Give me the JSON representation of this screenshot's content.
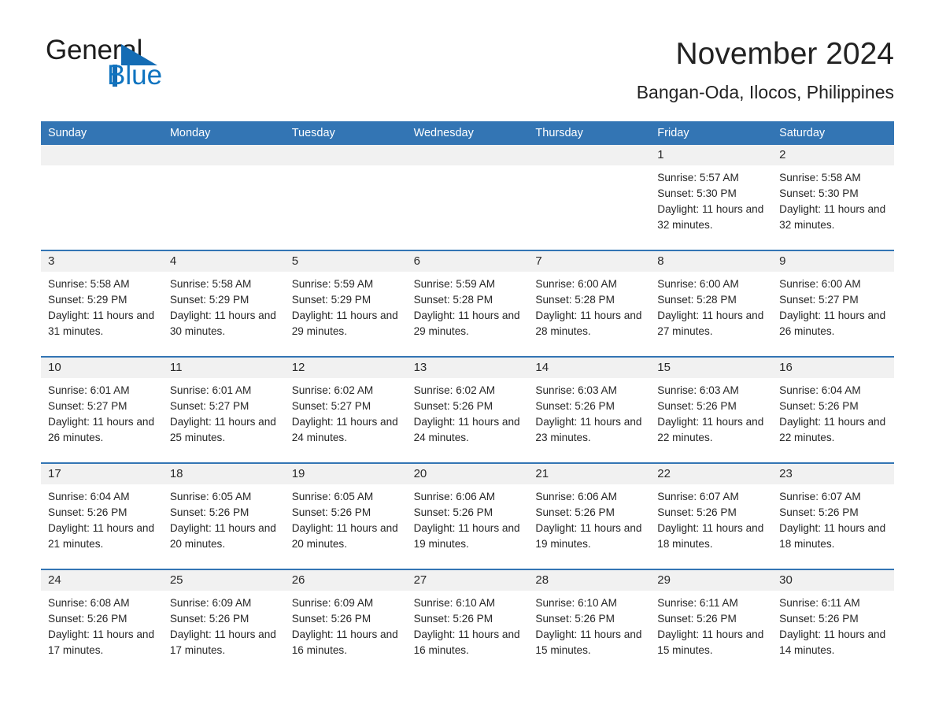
{
  "brand": {
    "word_one": "General",
    "word_two": "Blue",
    "triangle_color": "#146cb4",
    "blue_text_color": "#0f74c0",
    "dark_text_color": "#1c1c1c"
  },
  "header": {
    "month_title": "November 2024",
    "location": "Bangan-Oda, Ilocos, Philippines"
  },
  "theme": {
    "header_blue": "#3375b4",
    "date_band_gray": "#f1f1f1",
    "rule_blue": "#3375b4",
    "text_color": "#262626"
  },
  "calendar": {
    "weekdays": [
      "Sunday",
      "Monday",
      "Tuesday",
      "Wednesday",
      "Thursday",
      "Friday",
      "Saturday"
    ],
    "weeks": [
      [
        {
          "day": "",
          "sunrise": "",
          "sunset": "",
          "daylight": "",
          "empty": true
        },
        {
          "day": "",
          "sunrise": "",
          "sunset": "",
          "daylight": "",
          "empty": true
        },
        {
          "day": "",
          "sunrise": "",
          "sunset": "",
          "daylight": "",
          "empty": true
        },
        {
          "day": "",
          "sunrise": "",
          "sunset": "",
          "daylight": "",
          "empty": true
        },
        {
          "day": "",
          "sunrise": "",
          "sunset": "",
          "daylight": "",
          "empty": true
        },
        {
          "day": "1",
          "sunrise": "Sunrise: 5:57 AM",
          "sunset": "Sunset: 5:30 PM",
          "daylight": "Daylight: 11 hours and 32 minutes.",
          "empty": false
        },
        {
          "day": "2",
          "sunrise": "Sunrise: 5:58 AM",
          "sunset": "Sunset: 5:30 PM",
          "daylight": "Daylight: 11 hours and 32 minutes.",
          "empty": false
        }
      ],
      [
        {
          "day": "3",
          "sunrise": "Sunrise: 5:58 AM",
          "sunset": "Sunset: 5:29 PM",
          "daylight": "Daylight: 11 hours and 31 minutes.",
          "empty": false
        },
        {
          "day": "4",
          "sunrise": "Sunrise: 5:58 AM",
          "sunset": "Sunset: 5:29 PM",
          "daylight": "Daylight: 11 hours and 30 minutes.",
          "empty": false
        },
        {
          "day": "5",
          "sunrise": "Sunrise: 5:59 AM",
          "sunset": "Sunset: 5:29 PM",
          "daylight": "Daylight: 11 hours and 29 minutes.",
          "empty": false
        },
        {
          "day": "6",
          "sunrise": "Sunrise: 5:59 AM",
          "sunset": "Sunset: 5:28 PM",
          "daylight": "Daylight: 11 hours and 29 minutes.",
          "empty": false
        },
        {
          "day": "7",
          "sunrise": "Sunrise: 6:00 AM",
          "sunset": "Sunset: 5:28 PM",
          "daylight": "Daylight: 11 hours and 28 minutes.",
          "empty": false
        },
        {
          "day": "8",
          "sunrise": "Sunrise: 6:00 AM",
          "sunset": "Sunset: 5:28 PM",
          "daylight": "Daylight: 11 hours and 27 minutes.",
          "empty": false
        },
        {
          "day": "9",
          "sunrise": "Sunrise: 6:00 AM",
          "sunset": "Sunset: 5:27 PM",
          "daylight": "Daylight: 11 hours and 26 minutes.",
          "empty": false
        }
      ],
      [
        {
          "day": "10",
          "sunrise": "Sunrise: 6:01 AM",
          "sunset": "Sunset: 5:27 PM",
          "daylight": "Daylight: 11 hours and 26 minutes.",
          "empty": false
        },
        {
          "day": "11",
          "sunrise": "Sunrise: 6:01 AM",
          "sunset": "Sunset: 5:27 PM",
          "daylight": "Daylight: 11 hours and 25 minutes.",
          "empty": false
        },
        {
          "day": "12",
          "sunrise": "Sunrise: 6:02 AM",
          "sunset": "Sunset: 5:27 PM",
          "daylight": "Daylight: 11 hours and 24 minutes.",
          "empty": false
        },
        {
          "day": "13",
          "sunrise": "Sunrise: 6:02 AM",
          "sunset": "Sunset: 5:26 PM",
          "daylight": "Daylight: 11 hours and 24 minutes.",
          "empty": false
        },
        {
          "day": "14",
          "sunrise": "Sunrise: 6:03 AM",
          "sunset": "Sunset: 5:26 PM",
          "daylight": "Daylight: 11 hours and 23 minutes.",
          "empty": false
        },
        {
          "day": "15",
          "sunrise": "Sunrise: 6:03 AM",
          "sunset": "Sunset: 5:26 PM",
          "daylight": "Daylight: 11 hours and 22 minutes.",
          "empty": false
        },
        {
          "day": "16",
          "sunrise": "Sunrise: 6:04 AM",
          "sunset": "Sunset: 5:26 PM",
          "daylight": "Daylight: 11 hours and 22 minutes.",
          "empty": false
        }
      ],
      [
        {
          "day": "17",
          "sunrise": "Sunrise: 6:04 AM",
          "sunset": "Sunset: 5:26 PM",
          "daylight": "Daylight: 11 hours and 21 minutes.",
          "empty": false
        },
        {
          "day": "18",
          "sunrise": "Sunrise: 6:05 AM",
          "sunset": "Sunset: 5:26 PM",
          "daylight": "Daylight: 11 hours and 20 minutes.",
          "empty": false
        },
        {
          "day": "19",
          "sunrise": "Sunrise: 6:05 AM",
          "sunset": "Sunset: 5:26 PM",
          "daylight": "Daylight: 11 hours and 20 minutes.",
          "empty": false
        },
        {
          "day": "20",
          "sunrise": "Sunrise: 6:06 AM",
          "sunset": "Sunset: 5:26 PM",
          "daylight": "Daylight: 11 hours and 19 minutes.",
          "empty": false
        },
        {
          "day": "21",
          "sunrise": "Sunrise: 6:06 AM",
          "sunset": "Sunset: 5:26 PM",
          "daylight": "Daylight: 11 hours and 19 minutes.",
          "empty": false
        },
        {
          "day": "22",
          "sunrise": "Sunrise: 6:07 AM",
          "sunset": "Sunset: 5:26 PM",
          "daylight": "Daylight: 11 hours and 18 minutes.",
          "empty": false
        },
        {
          "day": "23",
          "sunrise": "Sunrise: 6:07 AM",
          "sunset": "Sunset: 5:26 PM",
          "daylight": "Daylight: 11 hours and 18 minutes.",
          "empty": false
        }
      ],
      [
        {
          "day": "24",
          "sunrise": "Sunrise: 6:08 AM",
          "sunset": "Sunset: 5:26 PM",
          "daylight": "Daylight: 11 hours and 17 minutes.",
          "empty": false
        },
        {
          "day": "25",
          "sunrise": "Sunrise: 6:09 AM",
          "sunset": "Sunset: 5:26 PM",
          "daylight": "Daylight: 11 hours and 17 minutes.",
          "empty": false
        },
        {
          "day": "26",
          "sunrise": "Sunrise: 6:09 AM",
          "sunset": "Sunset: 5:26 PM",
          "daylight": "Daylight: 11 hours and 16 minutes.",
          "empty": false
        },
        {
          "day": "27",
          "sunrise": "Sunrise: 6:10 AM",
          "sunset": "Sunset: 5:26 PM",
          "daylight": "Daylight: 11 hours and 16 minutes.",
          "empty": false
        },
        {
          "day": "28",
          "sunrise": "Sunrise: 6:10 AM",
          "sunset": "Sunset: 5:26 PM",
          "daylight": "Daylight: 11 hours and 15 minutes.",
          "empty": false
        },
        {
          "day": "29",
          "sunrise": "Sunrise: 6:11 AM",
          "sunset": "Sunset: 5:26 PM",
          "daylight": "Daylight: 11 hours and 15 minutes.",
          "empty": false
        },
        {
          "day": "30",
          "sunrise": "Sunrise: 6:11 AM",
          "sunset": "Sunset: 5:26 PM",
          "daylight": "Daylight: 11 hours and 14 minutes.",
          "empty": false
        }
      ]
    ]
  }
}
